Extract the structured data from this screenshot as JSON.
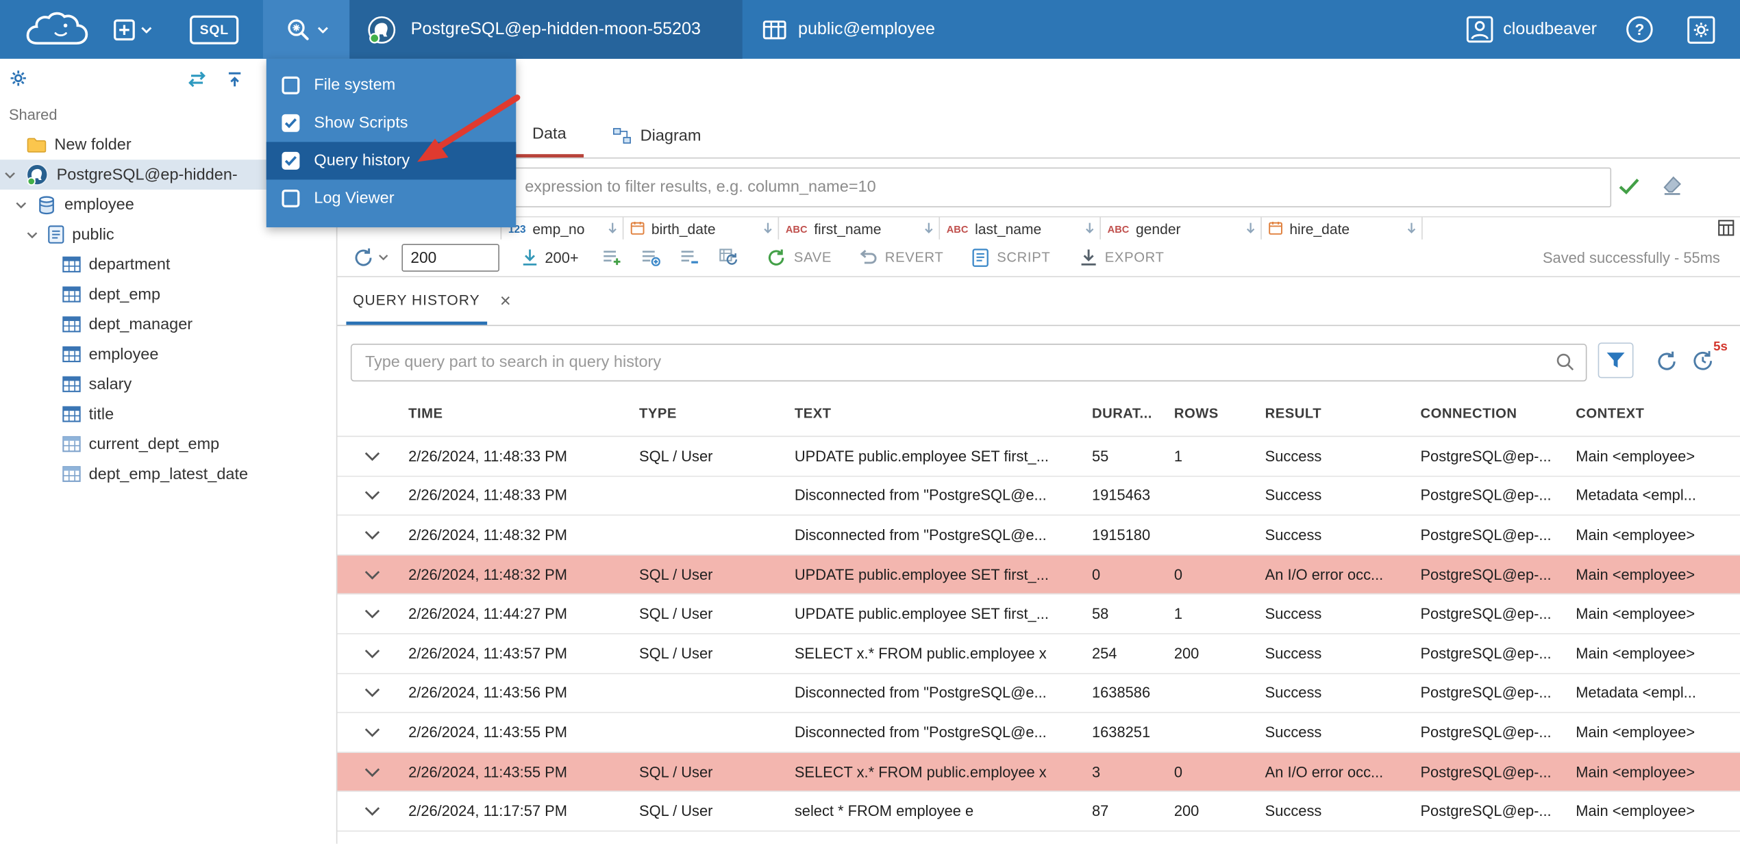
{
  "topbar": {
    "sql_label": "SQL",
    "connection_label": "PostgreSQL@ep-hidden-moon-55203",
    "schema_label": "public@employee",
    "username": "cloudbeaver",
    "help_label": "?"
  },
  "view_menu": {
    "items": [
      {
        "label": "File system",
        "checked": false,
        "highlighted": false
      },
      {
        "label": "Show Scripts",
        "checked": true,
        "highlighted": false
      },
      {
        "label": "Query history",
        "checked": true,
        "highlighted": true
      },
      {
        "label": "Log Viewer",
        "checked": false,
        "highlighted": false
      }
    ]
  },
  "sidebar": {
    "section_label": "Shared",
    "items": [
      {
        "label": "New folder",
        "type": "folder"
      },
      {
        "label": "PostgreSQL@ep-hidden-",
        "type": "connection",
        "selected": true
      },
      {
        "label": "employee",
        "type": "database"
      },
      {
        "label": "public",
        "type": "schema"
      },
      {
        "label": "department",
        "type": "table"
      },
      {
        "label": "dept_emp",
        "type": "table"
      },
      {
        "label": "dept_manager",
        "type": "table"
      },
      {
        "label": "employee",
        "type": "table"
      },
      {
        "label": "salary",
        "type": "table"
      },
      {
        "label": "title",
        "type": "table"
      },
      {
        "label": "current_dept_emp",
        "type": "view"
      },
      {
        "label": "dept_emp_latest_date",
        "type": "view"
      }
    ]
  },
  "tabs": {
    "data_label": "Data",
    "diagram_label": "Diagram"
  },
  "filter_bar": {
    "expression_placeholder": "expression to filter results, e.g. column_name=10"
  },
  "data_grid": {
    "columns": [
      {
        "label": "emp_no",
        "type": "number"
      },
      {
        "label": "birth_date",
        "type": "date"
      },
      {
        "label": "first_name",
        "type": "string"
      },
      {
        "label": "last_name",
        "type": "string"
      },
      {
        "label": "gender",
        "type": "string"
      },
      {
        "label": "hire_date",
        "type": "date"
      }
    ]
  },
  "result_toolbar": {
    "row_limit_value": "200",
    "fetch_more_label": "200+",
    "save_label": "SAVE",
    "revert_label": "REVERT",
    "script_label": "SCRIPT",
    "export_label": "EXPORT",
    "status_message": "Saved successfully - 55ms"
  },
  "query_history": {
    "tab_label": "QUERY HISTORY",
    "close_label": "×",
    "search_placeholder": "Type query part to search in query history",
    "auto_refresh_badge": "5s",
    "columns": {
      "time": "TIME",
      "type": "TYPE",
      "text": "TEXT",
      "duration": "DURAT...",
      "rows": "ROWS",
      "result": "RESULT",
      "connection": "CONNECTION",
      "context": "CONTEXT"
    },
    "rows": [
      {
        "time": "2/26/2024, 11:48:33 PM",
        "type": "SQL / User",
        "text": "UPDATE public.employee SET first_...",
        "duration": "55",
        "row_count": "1",
        "result": "Success",
        "connection": "PostgreSQL@ep-...",
        "context": "Main <employee>",
        "error": false
      },
      {
        "time": "2/26/2024, 11:48:33 PM",
        "type": "",
        "text": "Disconnected from \"PostgreSQL@e...",
        "duration": "1915463",
        "row_count": "",
        "result": "Success",
        "connection": "PostgreSQL@ep-...",
        "context": "Metadata <empl...",
        "error": false
      },
      {
        "time": "2/26/2024, 11:48:32 PM",
        "type": "",
        "text": "Disconnected from \"PostgreSQL@e...",
        "duration": "1915180",
        "row_count": "",
        "result": "Success",
        "connection": "PostgreSQL@ep-...",
        "context": "Main <employee>",
        "error": false
      },
      {
        "time": "2/26/2024, 11:48:32 PM",
        "type": "SQL / User",
        "text": "UPDATE public.employee SET first_...",
        "duration": "0",
        "row_count": "0",
        "result": "An I/O error occ...",
        "connection": "PostgreSQL@ep-...",
        "context": "Main <employee>",
        "error": true
      },
      {
        "time": "2/26/2024, 11:44:27 PM",
        "type": "SQL / User",
        "text": "UPDATE public.employee SET first_...",
        "duration": "58",
        "row_count": "1",
        "result": "Success",
        "connection": "PostgreSQL@ep-...",
        "context": "Main <employee>",
        "error": false
      },
      {
        "time": "2/26/2024, 11:43:57 PM",
        "type": "SQL / User",
        "text": "SELECT x.* FROM public.employee x",
        "duration": "254",
        "row_count": "200",
        "result": "Success",
        "connection": "PostgreSQL@ep-...",
        "context": "Main <employee>",
        "error": false
      },
      {
        "time": "2/26/2024, 11:43:56 PM",
        "type": "",
        "text": "Disconnected from \"PostgreSQL@e...",
        "duration": "1638586",
        "row_count": "",
        "result": "Success",
        "connection": "PostgreSQL@ep-...",
        "context": "Metadata <empl...",
        "error": false
      },
      {
        "time": "2/26/2024, 11:43:55 PM",
        "type": "",
        "text": "Disconnected from \"PostgreSQL@e...",
        "duration": "1638251",
        "row_count": "",
        "result": "Success",
        "connection": "PostgreSQL@ep-...",
        "context": "Main <employee>",
        "error": false
      },
      {
        "time": "2/26/2024, 11:43:55 PM",
        "type": "SQL / User",
        "text": "SELECT x.* FROM public.employee x",
        "duration": "3",
        "row_count": "0",
        "result": "An I/O error occ...",
        "connection": "PostgreSQL@ep-...",
        "context": "Main <employee>",
        "error": true
      },
      {
        "time": "2/26/2024, 11:17:57 PM",
        "type": "SQL / User",
        "text": "select * FROM employee e",
        "duration": "87",
        "row_count": "200",
        "result": "Success",
        "connection": "PostgreSQL@ep-...",
        "context": "Main <employee>",
        "error": false
      }
    ]
  }
}
